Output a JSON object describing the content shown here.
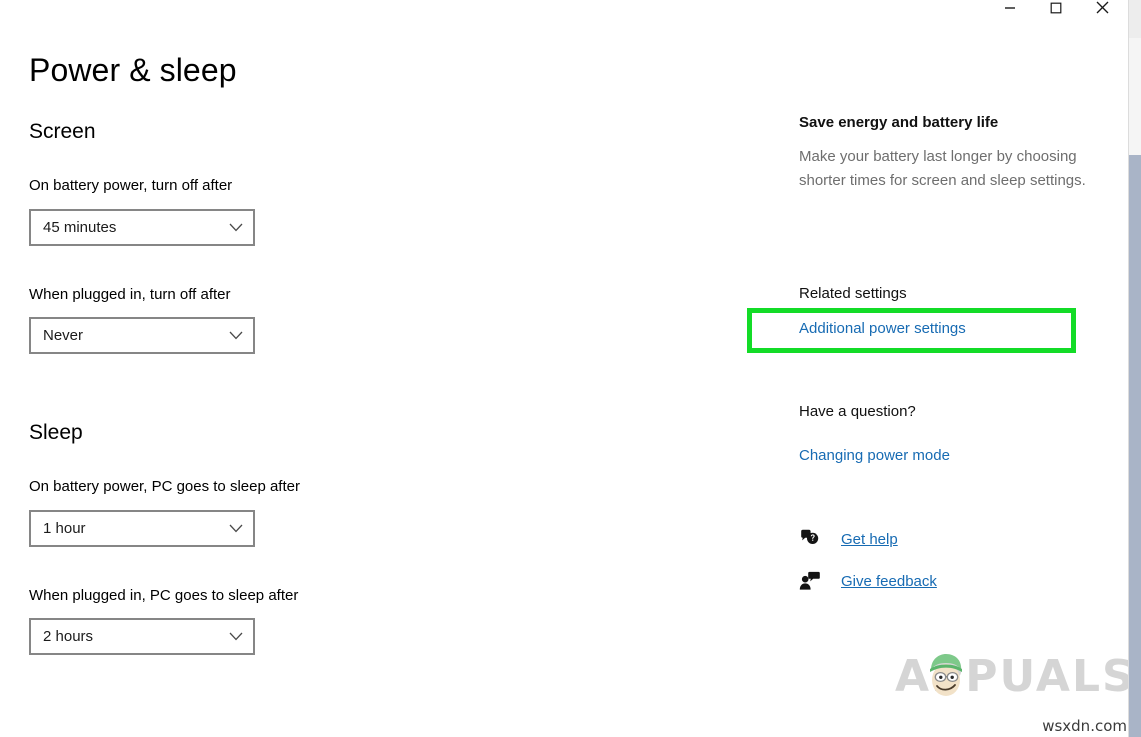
{
  "window": {
    "controls": [
      {
        "name": "minimize",
        "glyph": "minimize-icon"
      },
      {
        "name": "maximize",
        "glyph": "maximize-icon"
      },
      {
        "name": "close",
        "glyph": "close-icon"
      }
    ]
  },
  "page": {
    "title": "Power & sleep"
  },
  "sections": [
    {
      "heading": "Screen",
      "fields": [
        {
          "label": "On battery power, turn off after",
          "value": "45 minutes"
        },
        {
          "label": "When plugged in, turn off after",
          "value": "Never"
        }
      ]
    },
    {
      "heading": "Sleep",
      "fields": [
        {
          "label": "On battery power, PC goes to sleep after",
          "value": "1 hour"
        },
        {
          "label": "When plugged in, PC goes to sleep after",
          "value": "2 hours"
        }
      ]
    }
  ],
  "right_panel": {
    "tip_heading": "Save energy and battery life",
    "tip_body": "Make your battery last longer by choosing shorter times for screen and sleep settings.",
    "related_heading": "Related settings",
    "related_link": "Additional power settings",
    "question_heading": "Have a question?",
    "question_link": "Changing power mode",
    "help_links": [
      {
        "icon": "get-help-icon",
        "label": "Get help"
      },
      {
        "icon": "give-feedback-icon",
        "label": "Give feedback"
      }
    ]
  },
  "annotation": {
    "color": "#13dc27",
    "target": "Additional power settings"
  },
  "watermarks": {
    "brand": "APPUALS",
    "site": "wsxdn.com"
  },
  "colors": {
    "link": "#176bb3",
    "control_border": "#868686",
    "muted_text": "#6e6e6e",
    "highlight": "#13dc27"
  }
}
